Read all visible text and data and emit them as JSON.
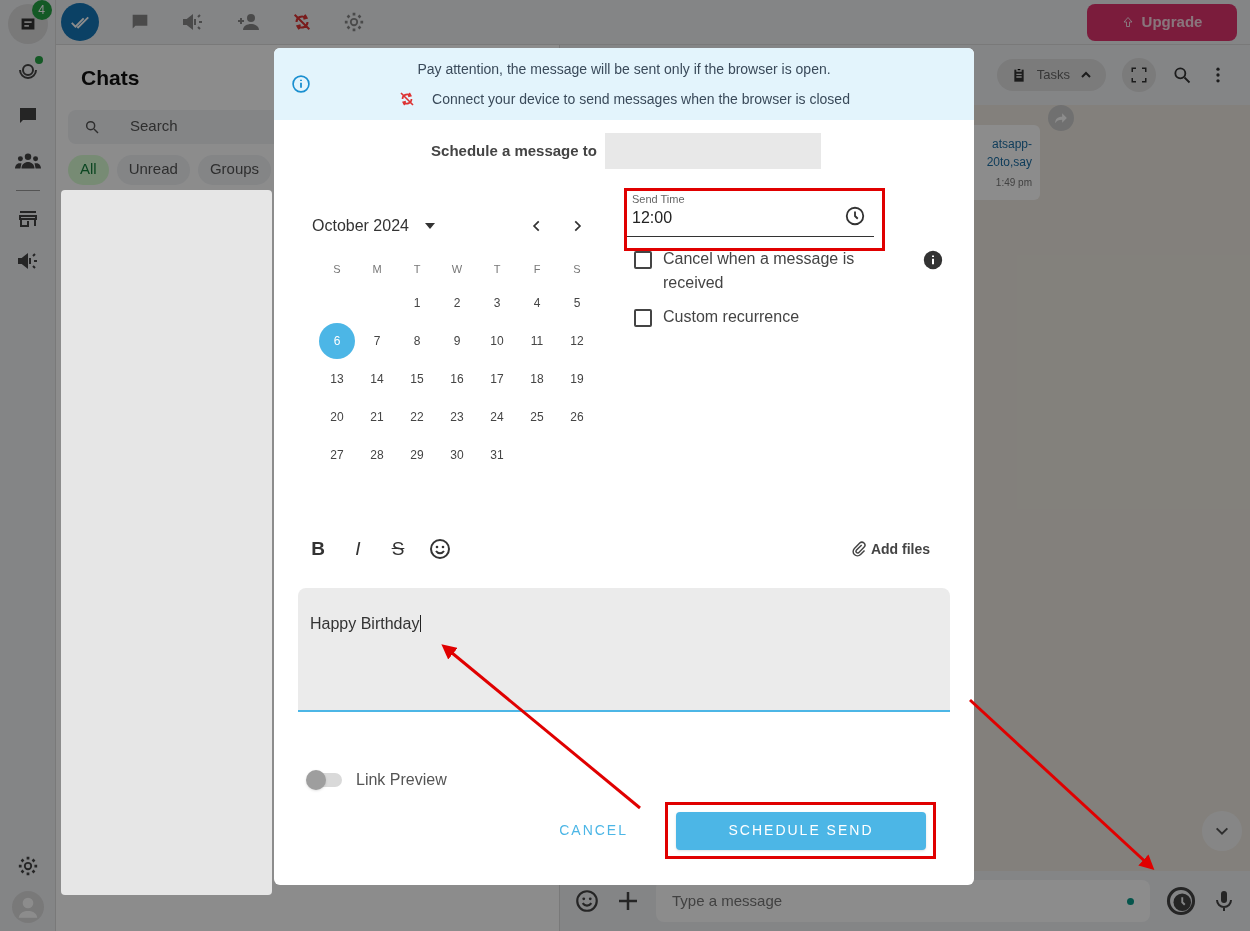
{
  "rail": {
    "badge": "4",
    "online": true
  },
  "top_bar": {
    "upgrade": "Upgrade"
  },
  "chats": {
    "title": "Chats",
    "search_placeholder": "Search",
    "filters": [
      {
        "label": "All",
        "selected": true
      },
      {
        "label": "Unread",
        "selected": false
      },
      {
        "label": "Groups",
        "selected": false
      }
    ]
  },
  "chat_header": {
    "tasks": "Tasks"
  },
  "message": {
    "lines": [
      "atsapp-",
      "20to,say"
    ],
    "time": "1:49 pm"
  },
  "composer": {
    "placeholder": "Type a message"
  },
  "dialog": {
    "notice": [
      "Pay attention, the message will be sent only if the browser is open.",
      "Connect your device to send messages when the browser is closed"
    ],
    "recipient_label": "Schedule a message to",
    "calendar": {
      "month": "October 2024",
      "weekdays": [
        "S",
        "M",
        "T",
        "W",
        "T",
        "F",
        "S"
      ],
      "weeks": [
        [
          {
            "day": "1",
            "selected": false
          },
          {
            "day": "2",
            "selected": false
          },
          {
            "day": "3",
            "selected": false
          },
          {
            "day": "4",
            "selected": false
          },
          {
            "day": "5",
            "selected": false
          }
        ],
        [
          {
            "day": "6",
            "selected": true
          },
          {
            "day": "7",
            "selected": false
          },
          {
            "day": "8",
            "selected": false
          },
          {
            "day": "9",
            "selected": false
          },
          {
            "day": "10",
            "selected": false
          },
          {
            "day": "11",
            "selected": false
          },
          {
            "day": "12",
            "selected": false
          }
        ],
        [
          {
            "day": "13",
            "selected": false
          },
          {
            "day": "14",
            "selected": false
          },
          {
            "day": "15",
            "selected": false
          },
          {
            "day": "16",
            "selected": false
          },
          {
            "day": "17",
            "selected": false
          },
          {
            "day": "18",
            "selected": false
          },
          {
            "day": "19",
            "selected": false
          }
        ],
        [
          {
            "day": "20",
            "selected": false
          },
          {
            "day": "21",
            "selected": false
          },
          {
            "day": "22",
            "selected": false
          },
          {
            "day": "23",
            "selected": false
          },
          {
            "day": "24",
            "selected": false
          },
          {
            "day": "25",
            "selected": false
          },
          {
            "day": "26",
            "selected": false
          }
        ],
        [
          {
            "day": "27",
            "selected": false
          },
          {
            "day": "28",
            "selected": false
          },
          {
            "day": "29",
            "selected": false
          },
          {
            "day": "30",
            "selected": false
          },
          {
            "day": "31",
            "selected": false
          }
        ]
      ]
    },
    "send_time": {
      "label": "Send Time",
      "value": "12:00"
    },
    "options": [
      {
        "label": "Cancel when a message is received",
        "checked": false,
        "info": true
      },
      {
        "label": "Custom recurrence",
        "checked": false,
        "info": false
      }
    ],
    "format_buttons": [
      "B",
      "I",
      "S"
    ],
    "add_files": "Add files",
    "message": "Happy Birthday",
    "link_preview": {
      "label": "Link Preview",
      "on": false
    },
    "cancel": "CANCEL",
    "submit": "SCHEDULE SEND"
  }
}
